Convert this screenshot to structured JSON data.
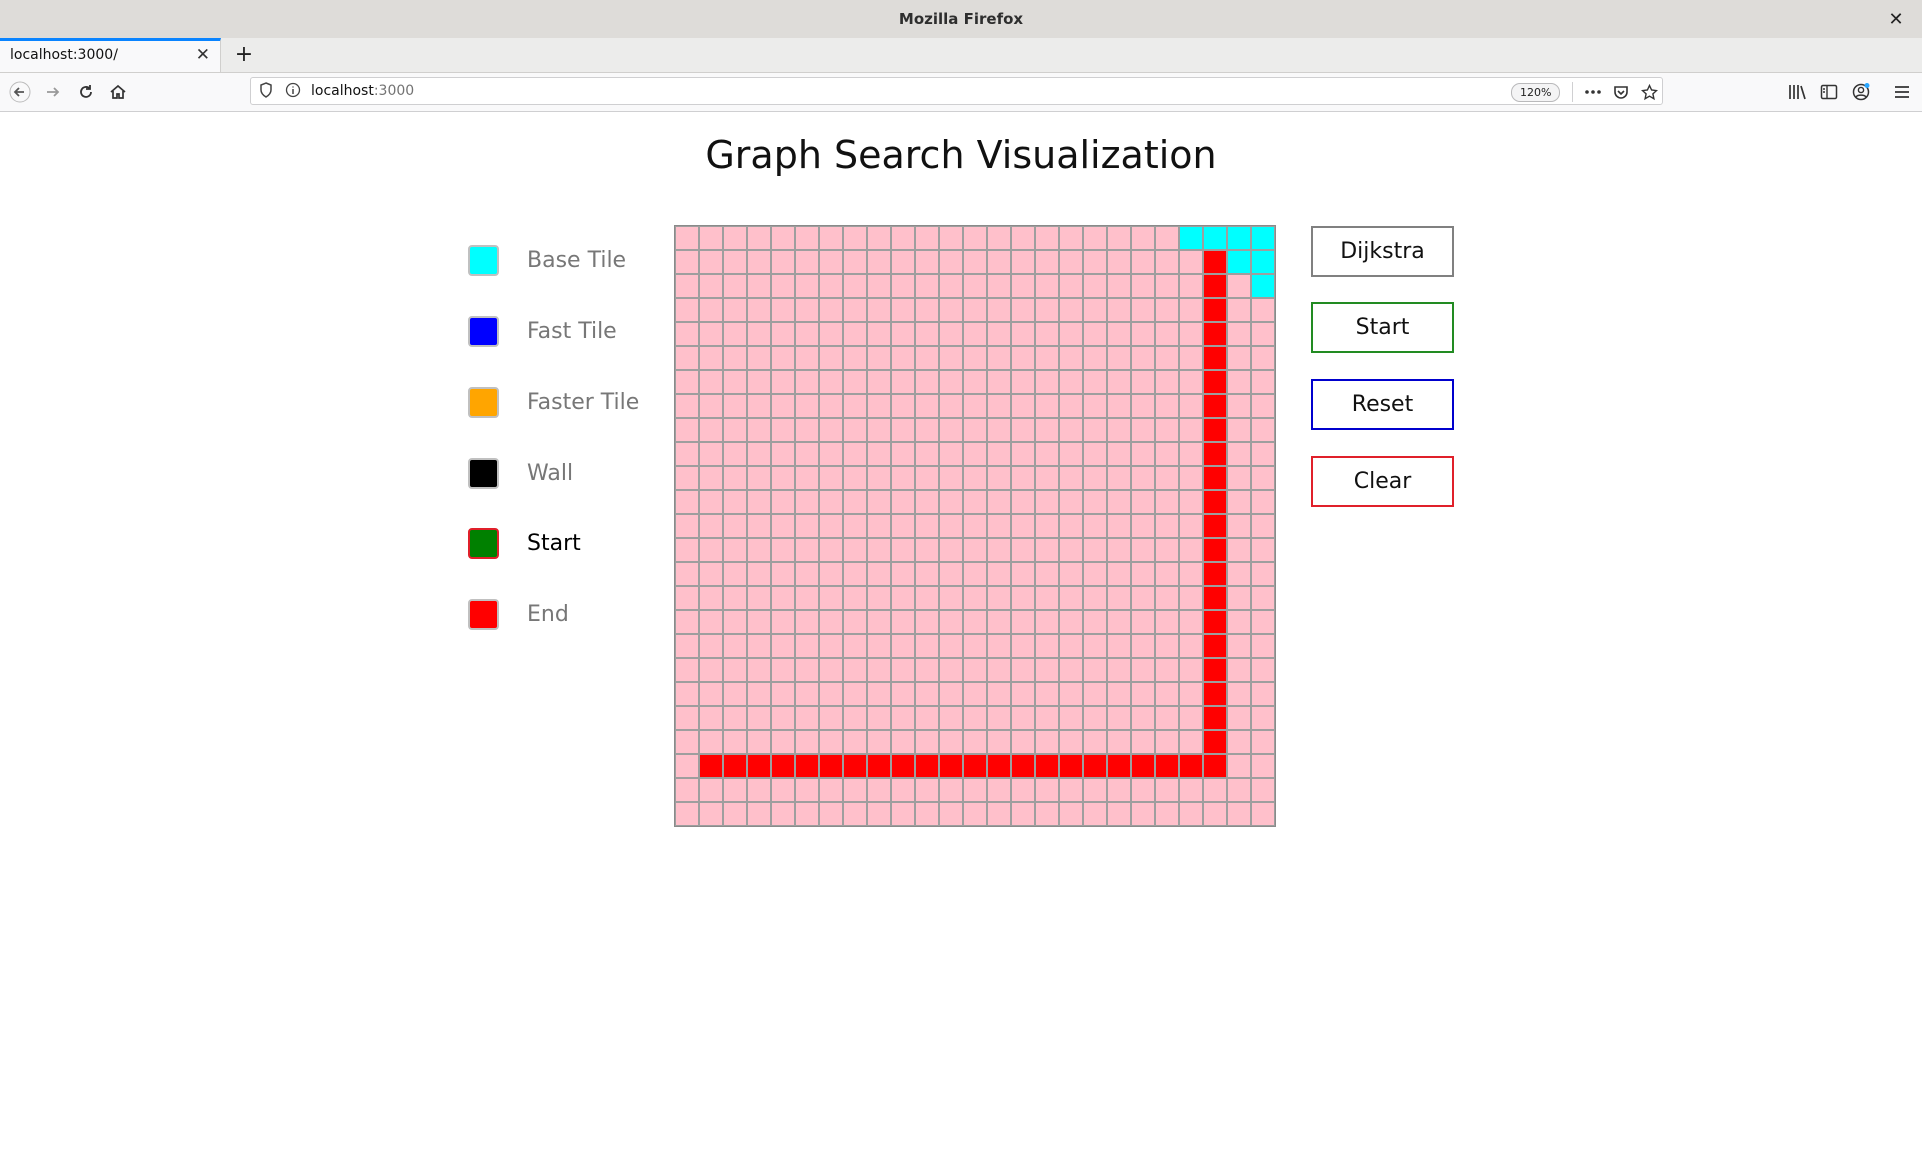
{
  "window": {
    "title": "Mozilla Firefox"
  },
  "tab": {
    "label": "localhost:3000/"
  },
  "urlbar": {
    "host": "localhost",
    "port": ":3000",
    "zoom": "120%"
  },
  "page": {
    "title": "Graph Search Visualization"
  },
  "legend": [
    {
      "label": "Base Tile",
      "color": "#00ffff",
      "selected": false
    },
    {
      "label": "Fast Tile",
      "color": "#0000ff",
      "selected": false
    },
    {
      "label": "Faster Tile",
      "color": "#ffa500",
      "selected": false
    },
    {
      "label": "Wall",
      "color": "#000000",
      "selected": false
    },
    {
      "label": "Start",
      "color": "#008000",
      "selected": true
    },
    {
      "label": "End",
      "color": "#ff0000",
      "selected": false
    }
  ],
  "buttons": {
    "algorithm": {
      "label": "Dijkstra",
      "border": "#808080"
    },
    "start": {
      "label": "Start",
      "border": "#228b22"
    },
    "reset": {
      "label": "Reset",
      "border": "#0000cd"
    },
    "clear": {
      "label": "Clear",
      "border": "#e0202a"
    }
  },
  "grid": {
    "rows": 25,
    "cols": 25,
    "default_color": "#ffc0cb",
    "tile_colors": {
      "B": "#00ffff",
      "E": "#ff0000"
    },
    "tiles": [
      "000000000000000000000BBBB",
      "0000000000000000000000EBB",
      "0000000000000000000000E0B",
      "0000000000000000000000E00",
      "0000000000000000000000E00",
      "0000000000000000000000E00",
      "0000000000000000000000E00",
      "0000000000000000000000E00",
      "0000000000000000000000E00",
      "0000000000000000000000E00",
      "0000000000000000000000E00",
      "0000000000000000000000E00",
      "0000000000000000000000E00",
      "0000000000000000000000E00",
      "0000000000000000000000E00",
      "0000000000000000000000E00",
      "0000000000000000000000E00",
      "0000000000000000000000E00",
      "0000000000000000000000E00",
      "0000000000000000000000E00",
      "0000000000000000000000E00",
      "0000000000000000000000E00",
      "0EEEEEEEEEEEEEEEEEEEEEE00",
      "0000000000000000000000000",
      "0000000000000000000000000"
    ]
  }
}
